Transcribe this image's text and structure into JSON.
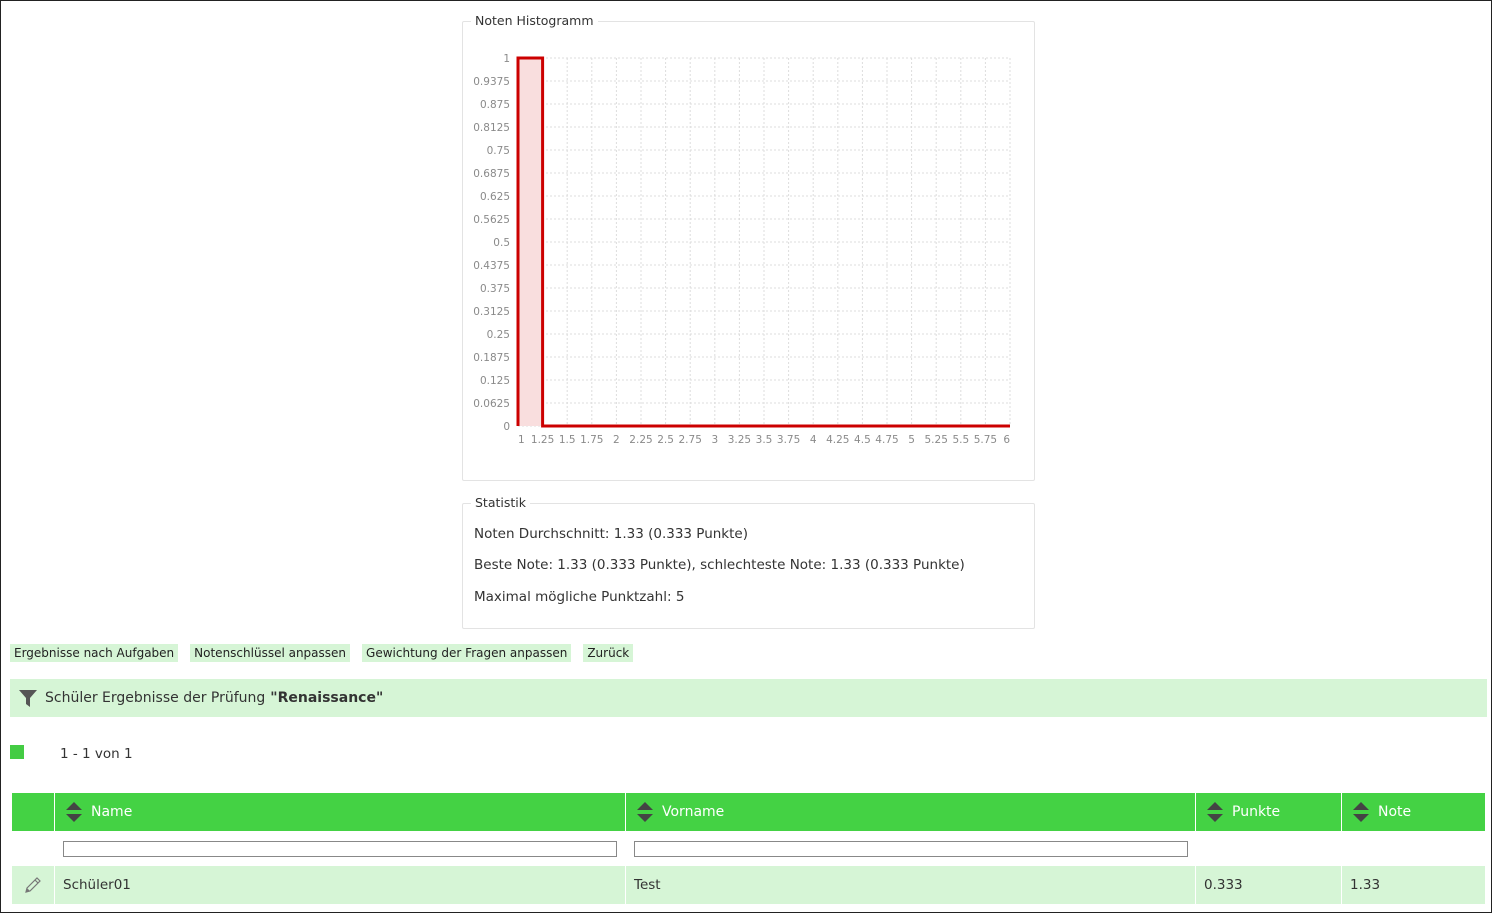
{
  "histogram": {
    "legend": "Noten Histogramm"
  },
  "chart_data": {
    "type": "line",
    "y_ticks": [
      "0",
      "0.0625",
      "0.125",
      "0.1875",
      "0.25",
      "0.3125",
      "0.375",
      "0.4375",
      "0.5",
      "0.5625",
      "0.625",
      "0.6875",
      "0.75",
      "0.8125",
      "0.875",
      "0.9375",
      "1"
    ],
    "x_tick_labels": [
      "1",
      "1.25",
      "1.5",
      "1.75",
      "2",
      "2.25",
      "2.5",
      "2.75",
      "3",
      "3.25",
      "3.5",
      "3.75",
      "4",
      "4.25",
      "4.5",
      "4.75",
      "5",
      "5.25",
      "5.5",
      "5.75",
      "6"
    ],
    "ylim": [
      0,
      1
    ],
    "xlim": [
      1,
      6
    ],
    "series": [
      {
        "color": "#cc0000",
        "fill": "#f9dede",
        "points": [
          [
            1,
            0
          ],
          [
            1,
            1
          ],
          [
            1.25,
            1
          ],
          [
            1.25,
            0
          ],
          [
            6,
            0
          ]
        ]
      }
    ],
    "grid": true
  },
  "statistics": {
    "legend": "Statistik",
    "average": "Noten Durchschnitt: 1.33 (0.333 Punkte)",
    "best_worst": "Beste Note: 1.33 (0.333 Punkte), schlechteste Note: 1.33 (0.333 Punkte)",
    "max_points": "Maximal mögliche Punktzahl: 5"
  },
  "buttons": {
    "results_by_task": "Ergebnisse nach Aufgaben",
    "grade_key": "Notenschlüssel anpassen",
    "weighting": "Gewichtung der Fragen anpassen",
    "back": "Zurück"
  },
  "panel": {
    "title_prefix": "Schüler Ergebnisse der Prüfung",
    "exam_name": "\"Renaissance\"",
    "filter_icon": "filter-icon"
  },
  "pager": {
    "range": "1 - 1 von 1"
  },
  "table": {
    "columns": [
      "Name",
      "Vorname",
      "Punkte",
      "Note"
    ],
    "rows": [
      {
        "edit_icon": "pencil-icon",
        "name": "Schüler01",
        "vorname": "Test",
        "punkte": "0.333",
        "note": "1.33"
      }
    ]
  },
  "colors": {
    "header_green": "#44d244",
    "light_green": "#d6f5d6",
    "chart_line": "#cc0000"
  }
}
